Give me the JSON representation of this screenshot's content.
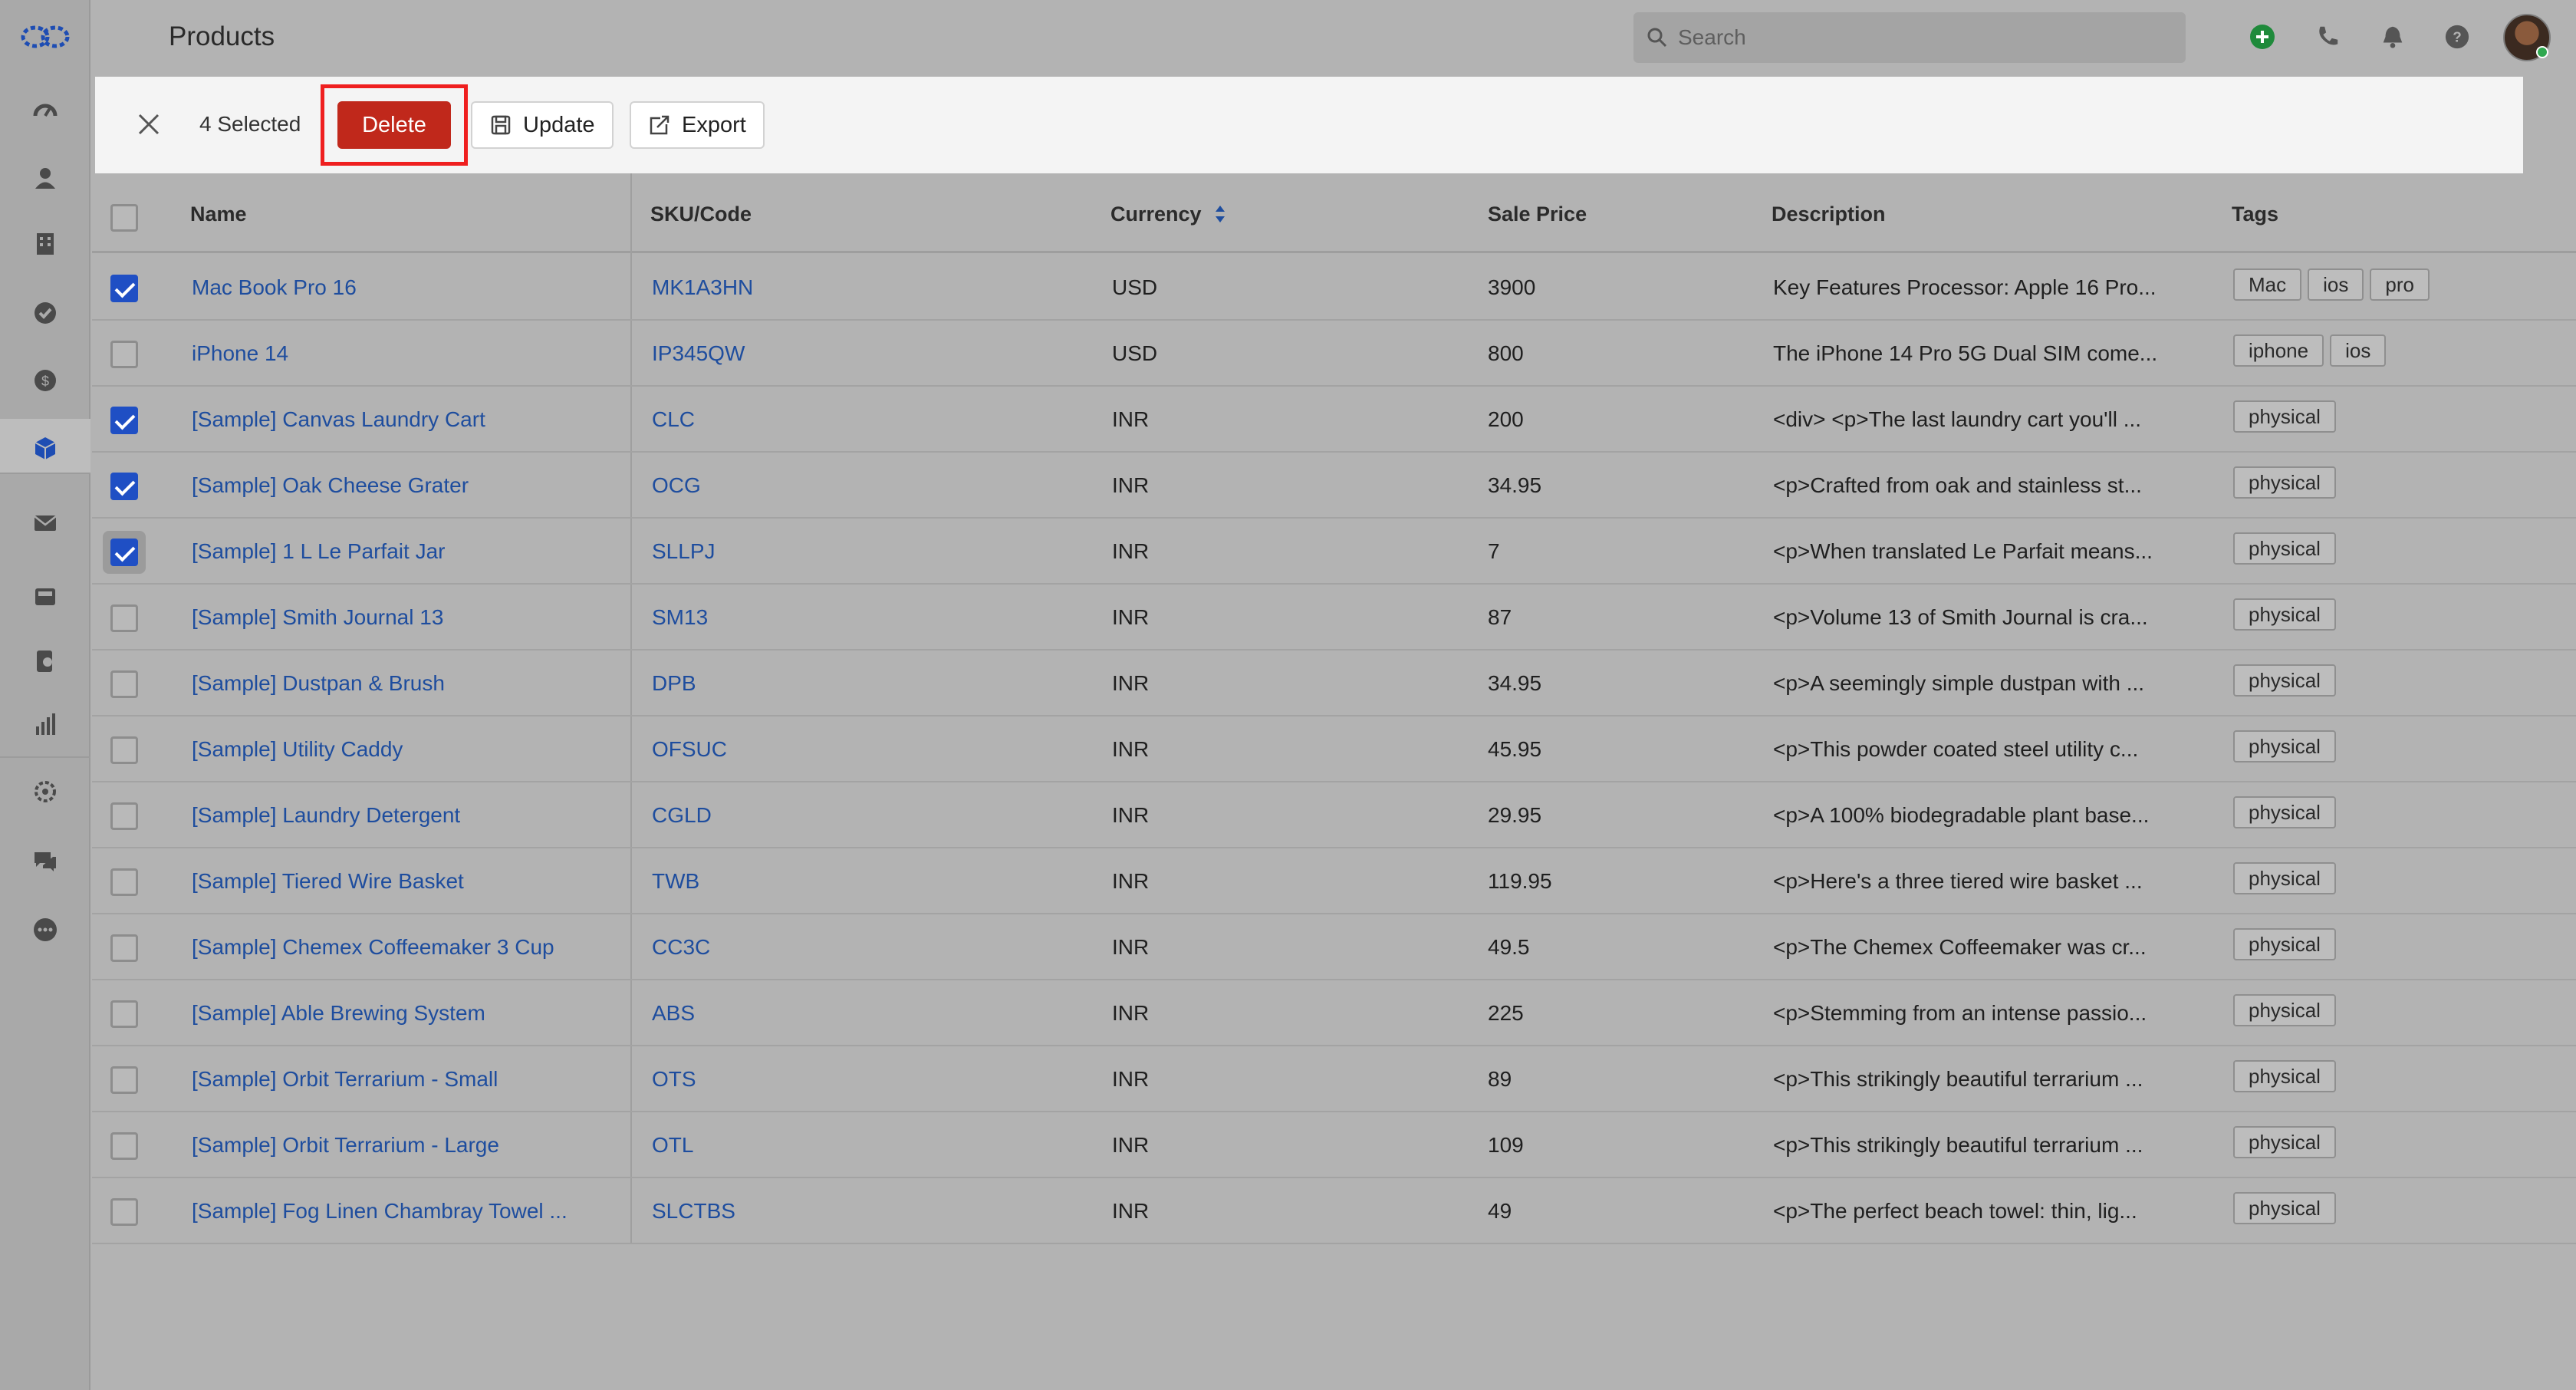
{
  "header": {
    "title": "Products",
    "search_placeholder": "Search"
  },
  "actionbar": {
    "selected_text": "4 Selected",
    "delete_label": "Delete",
    "update_label": "Update",
    "export_label": "Export"
  },
  "table": {
    "columns": [
      "Name",
      "SKU/Code",
      "Currency",
      "Sale Price",
      "Description",
      "Tags"
    ],
    "rows": [
      {
        "checked": true,
        "name": "Mac Book Pro 16",
        "sku": "MK1A3HN",
        "currency": "USD",
        "price": "3900",
        "description": "Key Features Processor: Apple 16 Pro...",
        "tags": [
          "Mac",
          "ios",
          "pro"
        ]
      },
      {
        "checked": false,
        "name": "iPhone 14",
        "sku": "IP345QW",
        "currency": "USD",
        "price": "800",
        "description": "The iPhone 14 Pro 5G Dual SIM come...",
        "tags": [
          "iphone",
          "ios"
        ]
      },
      {
        "checked": true,
        "name": "[Sample] Canvas Laundry Cart",
        "sku": "CLC",
        "currency": "INR",
        "price": "200",
        "description": "<div> <p>The last laundry cart you'll ...",
        "tags": [
          "physical"
        ]
      },
      {
        "checked": true,
        "name": "[Sample] Oak Cheese Grater",
        "sku": "OCG",
        "currency": "INR",
        "price": "34.95",
        "description": "<p>Crafted from oak and stainless st...",
        "tags": [
          "physical"
        ]
      },
      {
        "checked": true,
        "name": "[Sample] 1 L Le Parfait Jar",
        "sku": "SLLPJ",
        "currency": "INR",
        "price": "7",
        "description": "<p>When translated Le Parfait means...",
        "tags": [
          "physical"
        ]
      },
      {
        "checked": false,
        "name": "[Sample] Smith Journal 13",
        "sku": "SM13",
        "currency": "INR",
        "price": "87",
        "description": "<p>Volume 13 of Smith Journal is cra...",
        "tags": [
          "physical"
        ]
      },
      {
        "checked": false,
        "name": "[Sample] Dustpan & Brush",
        "sku": "DPB",
        "currency": "INR",
        "price": "34.95",
        "description": "<p>A seemingly simple dustpan with ...",
        "tags": [
          "physical"
        ]
      },
      {
        "checked": false,
        "name": "[Sample] Utility Caddy",
        "sku": "OFSUC",
        "currency": "INR",
        "price": "45.95",
        "description": "<p>This powder coated steel utility c...",
        "tags": [
          "physical"
        ]
      },
      {
        "checked": false,
        "name": "[Sample] Laundry Detergent",
        "sku": "CGLD",
        "currency": "INR",
        "price": "29.95",
        "description": "<p>A 100% biodegradable plant base...",
        "tags": [
          "physical"
        ]
      },
      {
        "checked": false,
        "name": "[Sample] Tiered Wire Basket",
        "sku": "TWB",
        "currency": "INR",
        "price": "119.95",
        "description": "<p>Here's a three tiered wire basket ...",
        "tags": [
          "physical"
        ]
      },
      {
        "checked": false,
        "name": "[Sample] Chemex Coffeemaker 3 Cup",
        "sku": "CC3C",
        "currency": "INR",
        "price": "49.5",
        "description": "<p>The Chemex Coffeemaker was cr...",
        "tags": [
          "physical"
        ]
      },
      {
        "checked": false,
        "name": "[Sample] Able Brewing System",
        "sku": "ABS",
        "currency": "INR",
        "price": "225",
        "description": "<p>Stemming from an intense passio...",
        "tags": [
          "physical"
        ]
      },
      {
        "checked": false,
        "name": "[Sample] Orbit Terrarium - Small",
        "sku": "OTS",
        "currency": "INR",
        "price": "89",
        "description": "<p>This strikingly beautiful terrarium ...",
        "tags": [
          "physical"
        ]
      },
      {
        "checked": false,
        "name": "[Sample] Orbit Terrarium - Large",
        "sku": "OTL",
        "currency": "INR",
        "price": "109",
        "description": "<p>This strikingly beautiful terrarium ...",
        "tags": [
          "physical"
        ]
      },
      {
        "checked": false,
        "name": "[Sample] Fog Linen Chambray Towel ...",
        "sku": "SLCTBS",
        "currency": "INR",
        "price": "49",
        "description": "<p>The perfect beach towel: thin, lig...",
        "tags": [
          "physical"
        ]
      }
    ]
  },
  "sidebar": {
    "icons": [
      "dashboard-icon",
      "contacts-icon",
      "company-icon",
      "deals-icon",
      "billing-icon",
      "products-icon",
      "email-icon",
      "inbox-icon",
      "phone-log-icon",
      "reports-icon",
      "automation-icon",
      "chat-icon",
      "more-icon"
    ]
  },
  "colors": {
    "accent": "#1f4fc4",
    "delete": "#c0281b",
    "link": "#1e4d9e",
    "highlight": "#ef1f1f"
  }
}
